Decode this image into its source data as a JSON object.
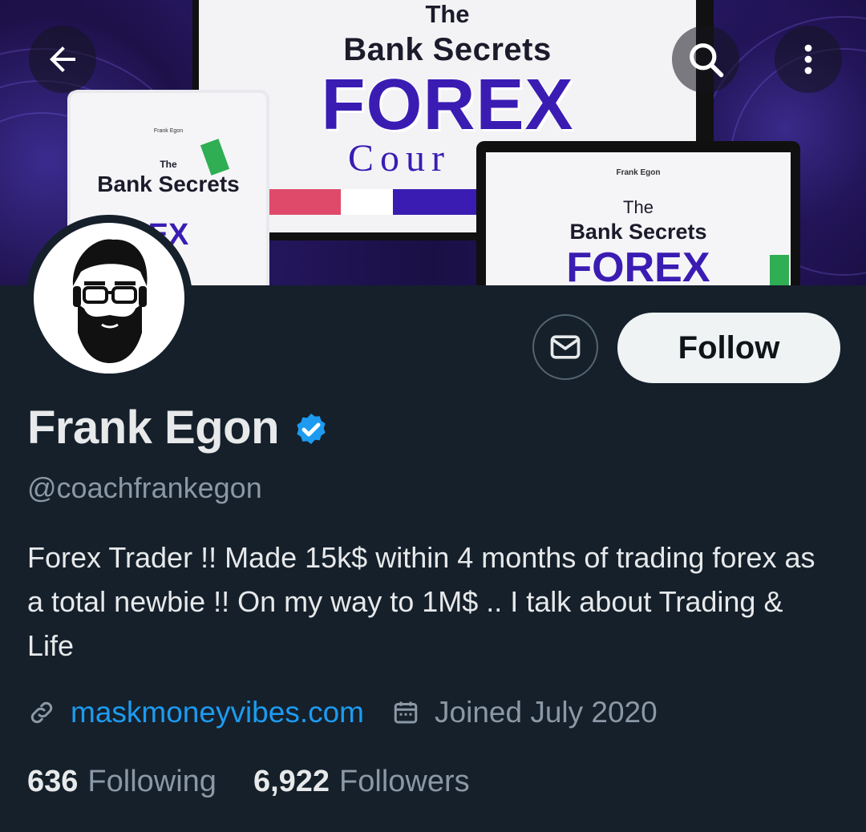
{
  "banner": {
    "monitor": {
      "line1": "The",
      "line2": "Bank Secrets",
      "line3": "FOREX",
      "line4": "Cour"
    },
    "tablet": {
      "small": "Frank Egon",
      "the": "The",
      "bank": "Bank Secrets",
      "forex": "EX"
    },
    "laptop": {
      "small": "Frank Egon",
      "the": "The",
      "bank": "Bank Secrets",
      "forex": "FOREX"
    }
  },
  "topbar": {
    "back_icon": "arrow-left-icon",
    "search_icon": "search-icon",
    "more_icon": "more-vertical-icon"
  },
  "profile": {
    "display_name": "Frank Egon",
    "handle": "@coachfrankegon",
    "bio": "Forex Trader !! Made 15k$ within 4 months of trading forex as a total newbie !! On my way to 1M$ .. I talk about Trading & Life",
    "website": "maskmoneyvibes.com",
    "joined": "Joined July 2020"
  },
  "actions": {
    "follow_label": "Follow",
    "message_icon": "mail-icon"
  },
  "stats": {
    "following_count": "636",
    "following_label": "Following",
    "followers_count": "6,922",
    "followers_label": "Followers"
  },
  "colors": {
    "background": "#15202b",
    "link": "#1d9bf0",
    "muted": "#8b98a5",
    "verified": "#1d9bf0"
  }
}
